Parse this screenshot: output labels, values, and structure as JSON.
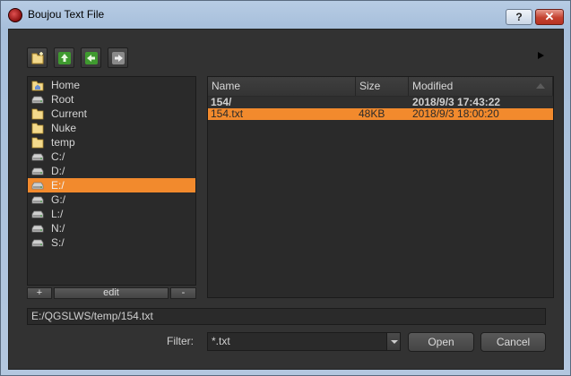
{
  "window": {
    "title": "Boujou Text File",
    "help_label": "?",
    "close_label": "✕"
  },
  "toolbar": {
    "buttons": [
      {
        "icon": "new-folder-icon"
      },
      {
        "icon": "up-arrow-icon"
      },
      {
        "icon": "back-arrow-icon"
      },
      {
        "icon": "forward-arrow-icon"
      }
    ]
  },
  "sidebar": {
    "items": [
      {
        "label": "Home",
        "icon": "home-folder-icon"
      },
      {
        "label": "Root",
        "icon": "drive-icon"
      },
      {
        "label": "Current",
        "icon": "folder-icon"
      },
      {
        "label": "Nuke",
        "icon": "folder-icon"
      },
      {
        "label": "temp",
        "icon": "folder-icon"
      },
      {
        "label": "C:/",
        "icon": "drive-icon"
      },
      {
        "label": "D:/",
        "icon": "drive-icon"
      },
      {
        "label": "E:/",
        "icon": "drive-icon",
        "selected": true
      },
      {
        "label": "G:/",
        "icon": "drive-icon"
      },
      {
        "label": "L:/",
        "icon": "drive-icon"
      },
      {
        "label": "N:/",
        "icon": "drive-icon"
      },
      {
        "label": "S:/",
        "icon": "drive-icon"
      }
    ],
    "add_label": "+",
    "edit_label": "edit",
    "remove_label": "-"
  },
  "file_list": {
    "columns": [
      "Name",
      "Size",
      "Modified"
    ],
    "rows": [
      {
        "name": "154/",
        "size": "",
        "modified": "2018/9/3 17:43:22",
        "type": "dir"
      },
      {
        "name": "154.txt",
        "size": "48KB",
        "modified": "2018/9/3 18:00:20",
        "type": "file",
        "selected": true
      }
    ]
  },
  "path": {
    "value": "E:/QGSLWS/temp/154.txt"
  },
  "filter": {
    "label": "Filter:",
    "value": "*.txt"
  },
  "buttons": {
    "open_label": "Open",
    "cancel_label": "Cancel"
  },
  "colors": {
    "accent": "#f28a2d",
    "panel": "#2a2a2a",
    "background": "#323232"
  }
}
